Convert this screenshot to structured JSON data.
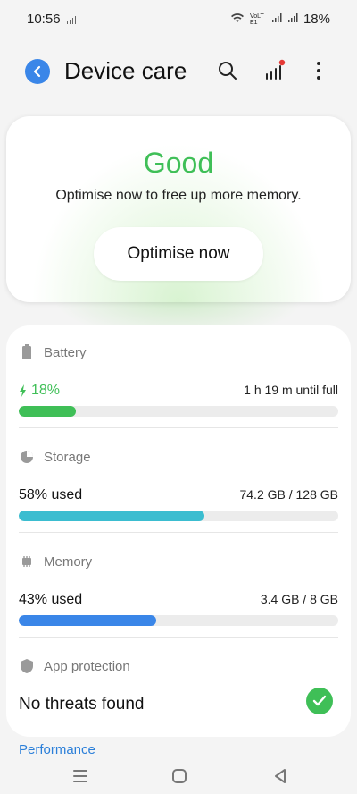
{
  "status_bar": {
    "time": "10:56",
    "network_label": "VoLTE1",
    "battery": "18%"
  },
  "header": {
    "title": "Device care"
  },
  "hero": {
    "status": "Good",
    "message": "Optimise now to free up more memory.",
    "button_label": "Optimise now"
  },
  "sections": {
    "battery": {
      "title": "Battery",
      "value": "18%",
      "detail": "1 h 19 m until full",
      "level": 0.18,
      "color": "#3fbf57"
    },
    "storage": {
      "title": "Storage",
      "value": "58% used",
      "detail": "74.2 GB / 128 GB",
      "level": 0.58,
      "color": "#3bbdd0"
    },
    "memory": {
      "title": "Memory",
      "value": "43% used",
      "detail": "3.4 GB / 8 GB",
      "level": 0.43,
      "color": "#3a86e8"
    },
    "protection": {
      "title": "App protection",
      "value": "No threats found"
    }
  },
  "performance": {
    "label": "Performance"
  },
  "colors": {
    "accent_blue": "#3a86e8",
    "good_green": "#3fbf57",
    "link_blue": "#2b7fd9"
  }
}
